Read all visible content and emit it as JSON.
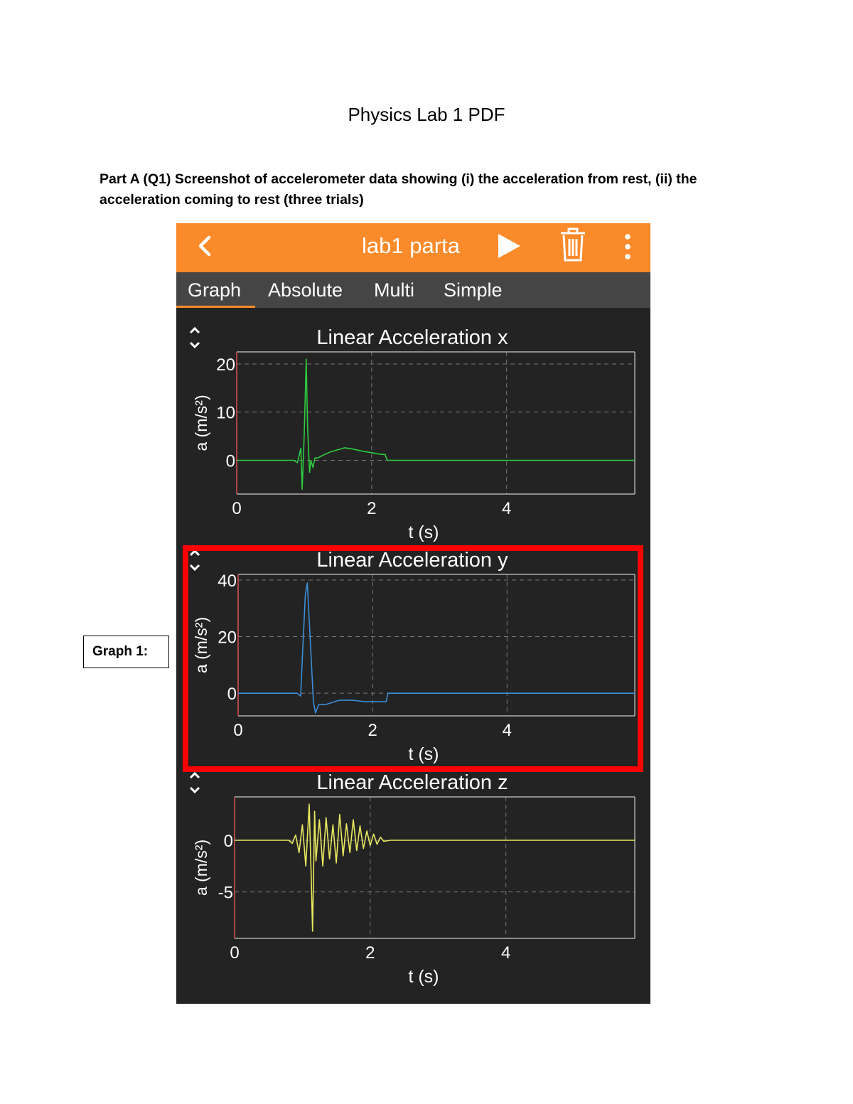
{
  "document": {
    "title": "Physics Lab 1 PDF",
    "paragraph_line1": "Part A (Q1) Screenshot of accelerometer data showing (i) the acceleration from rest, (ii) the",
    "paragraph_line2": "acceleration coming to rest (three trials)",
    "graph_label": "Graph 1:"
  },
  "app": {
    "title": "lab1 parta",
    "icons": [
      "back-chevron-icon",
      "play-icon",
      "trash-icon",
      "more-vert-icon"
    ],
    "accent_color": "#fb8a2a",
    "tabs": [
      {
        "label": "Graph",
        "active": true
      },
      {
        "label": "Absolute",
        "active": false
      },
      {
        "label": "Multi",
        "active": false
      },
      {
        "label": "Simple",
        "active": false
      }
    ]
  },
  "chart_data": [
    {
      "type": "line",
      "title": "Linear Acceleration x",
      "xlabel": "t (s)",
      "ylabel": "a (m/s²)",
      "color": "#2ecc40",
      "xlim": [
        0,
        5.9
      ],
      "ylim": [
        -7,
        22.5
      ],
      "xticks": [
        0,
        2,
        4
      ],
      "yticks": [
        0,
        10,
        20
      ],
      "grid": true,
      "x": [
        0,
        0.85,
        0.9,
        0.95,
        0.97,
        1.0,
        1.03,
        1.05,
        1.08,
        1.1,
        1.13,
        1.16,
        1.2,
        1.3,
        1.4,
        1.5,
        1.6,
        1.7,
        1.8,
        1.9,
        2.0,
        2.1,
        2.2,
        2.23,
        2.3,
        3.0,
        4.0,
        5.9
      ],
      "y": [
        0,
        0,
        -0.5,
        2.5,
        -6,
        5,
        21,
        7,
        -2.5,
        0,
        -1.5,
        0.5,
        0.5,
        1.2,
        1.8,
        2.2,
        2.6,
        2.4,
        2.1,
        1.8,
        1.6,
        1.3,
        1.2,
        0,
        0,
        0,
        0,
        0
      ]
    },
    {
      "type": "line",
      "title": "Linear Acceleration y",
      "xlabel": "t (s)",
      "ylabel": "a (m/s²)",
      "color": "#3b8ed8",
      "xlim": [
        0,
        5.9
      ],
      "ylim": [
        -8,
        42
      ],
      "xticks": [
        0,
        2,
        4
      ],
      "yticks": [
        0,
        20,
        40
      ],
      "grid": true,
      "x": [
        0,
        0.8,
        0.88,
        0.93,
        0.96,
        1.0,
        1.03,
        1.07,
        1.12,
        1.15,
        1.2,
        1.3,
        1.5,
        1.7,
        1.9,
        2.1,
        2.2,
        2.23,
        2.3,
        3.0,
        4.0,
        5.9
      ],
      "y": [
        0,
        0,
        0,
        -1,
        15,
        35,
        39,
        20,
        -3,
        -7,
        -4,
        -4,
        -2.5,
        -2.5,
        -3,
        -3,
        -3,
        0,
        0,
        0,
        0,
        0
      ]
    },
    {
      "type": "line",
      "title": "Linear Acceleration z",
      "xlabel": "t (s)",
      "ylabel": "a (m/s²)",
      "color": "#e8e860",
      "xlim": [
        0,
        5.9
      ],
      "ylim": [
        -9.5,
        4.2
      ],
      "xticks": [
        0,
        2,
        4
      ],
      "yticks": [
        0,
        -5
      ],
      "grid": true,
      "x": [
        0,
        0.8,
        0.85,
        0.9,
        0.95,
        1.0,
        1.05,
        1.1,
        1.13,
        1.15,
        1.18,
        1.2,
        1.25,
        1.3,
        1.35,
        1.4,
        1.45,
        1.5,
        1.55,
        1.6,
        1.65,
        1.7,
        1.75,
        1.8,
        1.85,
        1.9,
        1.95,
        2.0,
        2.05,
        2.1,
        2.15,
        2.2,
        2.3,
        3.0,
        5.9
      ],
      "y": [
        0,
        0,
        -0.3,
        0.5,
        -1.2,
        1.5,
        -2.5,
        3.5,
        -3.5,
        -8.8,
        2.8,
        -2,
        2,
        -2.5,
        2.2,
        -1.8,
        1.5,
        -2.2,
        2.5,
        -1.5,
        1.6,
        -1.2,
        2,
        -1,
        1.4,
        -0.8,
        0.9,
        -0.5,
        0.6,
        -0.4,
        0.3,
        -0.1,
        0,
        0,
        0
      ]
    }
  ]
}
